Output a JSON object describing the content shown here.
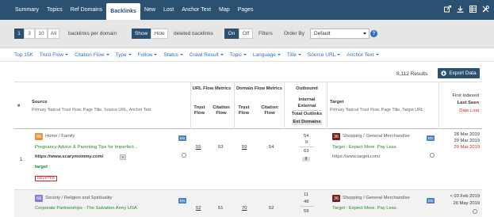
{
  "nav": {
    "tabs": [
      "Summary",
      "Topics",
      "Ref Domains",
      "Backlinks",
      "New",
      "Lost",
      "Anchor Text",
      "Map",
      "Pages"
    ],
    "active_tab": "Backlinks",
    "icons": [
      "share-icon",
      "download-icon",
      "table-icon",
      "tools-icon"
    ]
  },
  "options": {
    "per_page": [
      "1",
      "3",
      "10",
      "All"
    ],
    "per_page_label": "backlinks per domain",
    "deleted": [
      "Show",
      "Hide"
    ],
    "deleted_label": "deleted backlinks",
    "filters": [
      "On",
      "Off"
    ],
    "filters_label": "Filters",
    "order_by_label": "Order By",
    "order_by_value": "Default"
  },
  "filter_bar": [
    "Top 15K",
    "Trust Flow",
    "Citation Flow",
    "Type",
    "Follow",
    "Status",
    "Crawl Result",
    "Topic",
    "Language",
    "Title",
    "Source URL",
    "Anchor Text"
  ],
  "results": {
    "count": "8,112 Results",
    "export_label": "Export Data"
  },
  "table": {
    "headers": {
      "num": "#",
      "source": "Source",
      "source_sub": "Primary Topical Trust Flow, Page Title, Source URL, Anchor Text",
      "url_flow": "URL Flow Metrics",
      "domain_flow": "Domain Flow Metrics",
      "trust_flow": "Trust Flow",
      "citation_flow": "Citation Flow",
      "outbound": "Outbound",
      "internal": "Internal",
      "external": "External",
      "total_outlinks": "Total Outlinks",
      "ext_domains": "Ext Domains",
      "target": "Target",
      "target_sub": "Primary Topical Trust Flow, Page Title, Target URL",
      "first_indexed": "First Indexed",
      "last_seen": "Last Seen",
      "date_lost": "Date Lost"
    },
    "rows": [
      {
        "num": "1",
        "source_tf": "66",
        "source_topic": "Home / Family",
        "source_lang": "EN",
        "source_title": "Pregnancy Advice & Parenting Tips for Imperfect...",
        "source_url": "https://www.scarymommy.com/",
        "anchor": "target",
        "status_badge": "DELETED",
        "url_tf": "55",
        "url_cf": "53",
        "dom_tf": "59",
        "dom_cf": "54",
        "out_internal": "54",
        "out_external": "9",
        "out_total": "63",
        "out_ext_domains": "8",
        "target_tf": "36",
        "target_topic": "Shopping / General Merchandise",
        "target_lang": "EN",
        "target_title": "Target : Expect More. Pay Less.",
        "target_url": "https://www.target.com/",
        "first_indexed": "28 Mar 2019",
        "last_seen": "29 Mar 2019",
        "date_lost": "29 Mar 2019"
      },
      {
        "num": "2",
        "source_tf": "68",
        "source_topic": "Society / Religion and Spirituality",
        "source_lang": "EN",
        "source_title": "Corporate Partnerships - The Salvation Army USA",
        "source_url": "",
        "anchor": "",
        "status_badge": "",
        "url_tf": "52",
        "url_cf": "51",
        "dom_tf": "70",
        "dom_cf": "52",
        "out_internal": "11",
        "out_external": "48",
        "out_total": "59",
        "out_ext_domains": "",
        "target_tf": "36",
        "target_topic": "Shopping / General Merchandise",
        "target_lang": "EN",
        "target_title": "Target : Expect More. Pay Less.",
        "target_url": "",
        "first_indexed": "< 03 Feb 2019",
        "last_seen": "26 May 2019",
        "date_lost": ""
      }
    ]
  },
  "colors": {
    "nav_bg": "#2a5172",
    "accent": "#2a72c5",
    "green": "#1e8a24",
    "red": "#c62828",
    "tf_home": "#e8953a",
    "tf_society": "#8a7bd1",
    "tf_shopping": "#7a1f1f"
  }
}
